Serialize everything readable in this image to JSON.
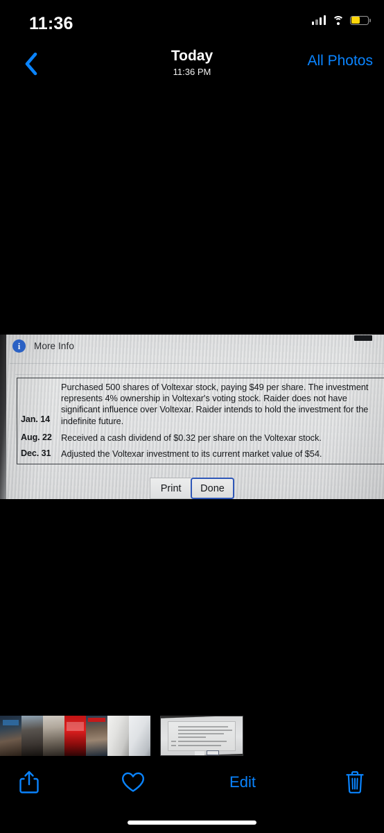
{
  "status_bar": {
    "time": "11:36",
    "cellular_icon": "cellular-bars-icon",
    "wifi_icon": "wifi-icon",
    "battery_icon": "battery-icon",
    "battery_color": "#ffd60a",
    "battery_level_percent": 45,
    "low_power_mode": true
  },
  "nav_bar": {
    "back_icon": "chevron-left-icon",
    "title": "Today",
    "subtitle": "11:36 PM",
    "all_photos_label": "All Photos",
    "accent_color": "#0a84ff"
  },
  "photo": {
    "description": "Photograph of a computer screen showing an accounting exercise dialog",
    "more_info": {
      "icon": "info-circle-icon",
      "label": "More Info",
      "icon_color": "#2b61c4"
    },
    "transactions": [
      {
        "date": "Jan. 14",
        "description": "Purchased 500 shares of Voltexar stock, paying $49 per share. The investment represents 4% ownership in Voltexar's voting stock. Raider does not have significant influence over Voltexar. Raider intends to hold the investment for the indefinite future."
      },
      {
        "date": "Aug. 22",
        "description": "Received a cash dividend of $0.32 per share on the Voltexar stock."
      },
      {
        "date": "Dec. 31",
        "description": "Adjusted the Voltexar investment to its current market value of $54."
      }
    ],
    "buttons": {
      "print_label": "Print",
      "done_label": "Done",
      "done_focused": true,
      "done_focus_color": "#2f57b8"
    }
  },
  "thumbnail_strip": {
    "thumbnails": [
      {
        "name": "thumbnail-person-a",
        "kind": "photo",
        "selected": false
      },
      {
        "name": "thumbnail-person-b",
        "kind": "photo",
        "selected": false
      },
      {
        "name": "thumbnail-person-c",
        "kind": "photo",
        "selected": false
      },
      {
        "name": "thumbnail-person-d",
        "kind": "photo",
        "selected": false
      },
      {
        "name": "thumbnail-person-e",
        "kind": "photo",
        "selected": false
      },
      {
        "name": "thumbnail-document-a",
        "kind": "document",
        "selected": false
      },
      {
        "name": "thumbnail-document-b",
        "kind": "document",
        "selected": false
      },
      {
        "name": "thumbnail-document-selected",
        "kind": "document",
        "selected": true
      }
    ]
  },
  "bottom_toolbar": {
    "share_icon": "share-icon",
    "favorite_icon": "heart-icon",
    "edit_label": "Edit",
    "delete_icon": "trash-icon",
    "accent_color": "#0a84ff"
  },
  "home_indicator": "home-indicator"
}
